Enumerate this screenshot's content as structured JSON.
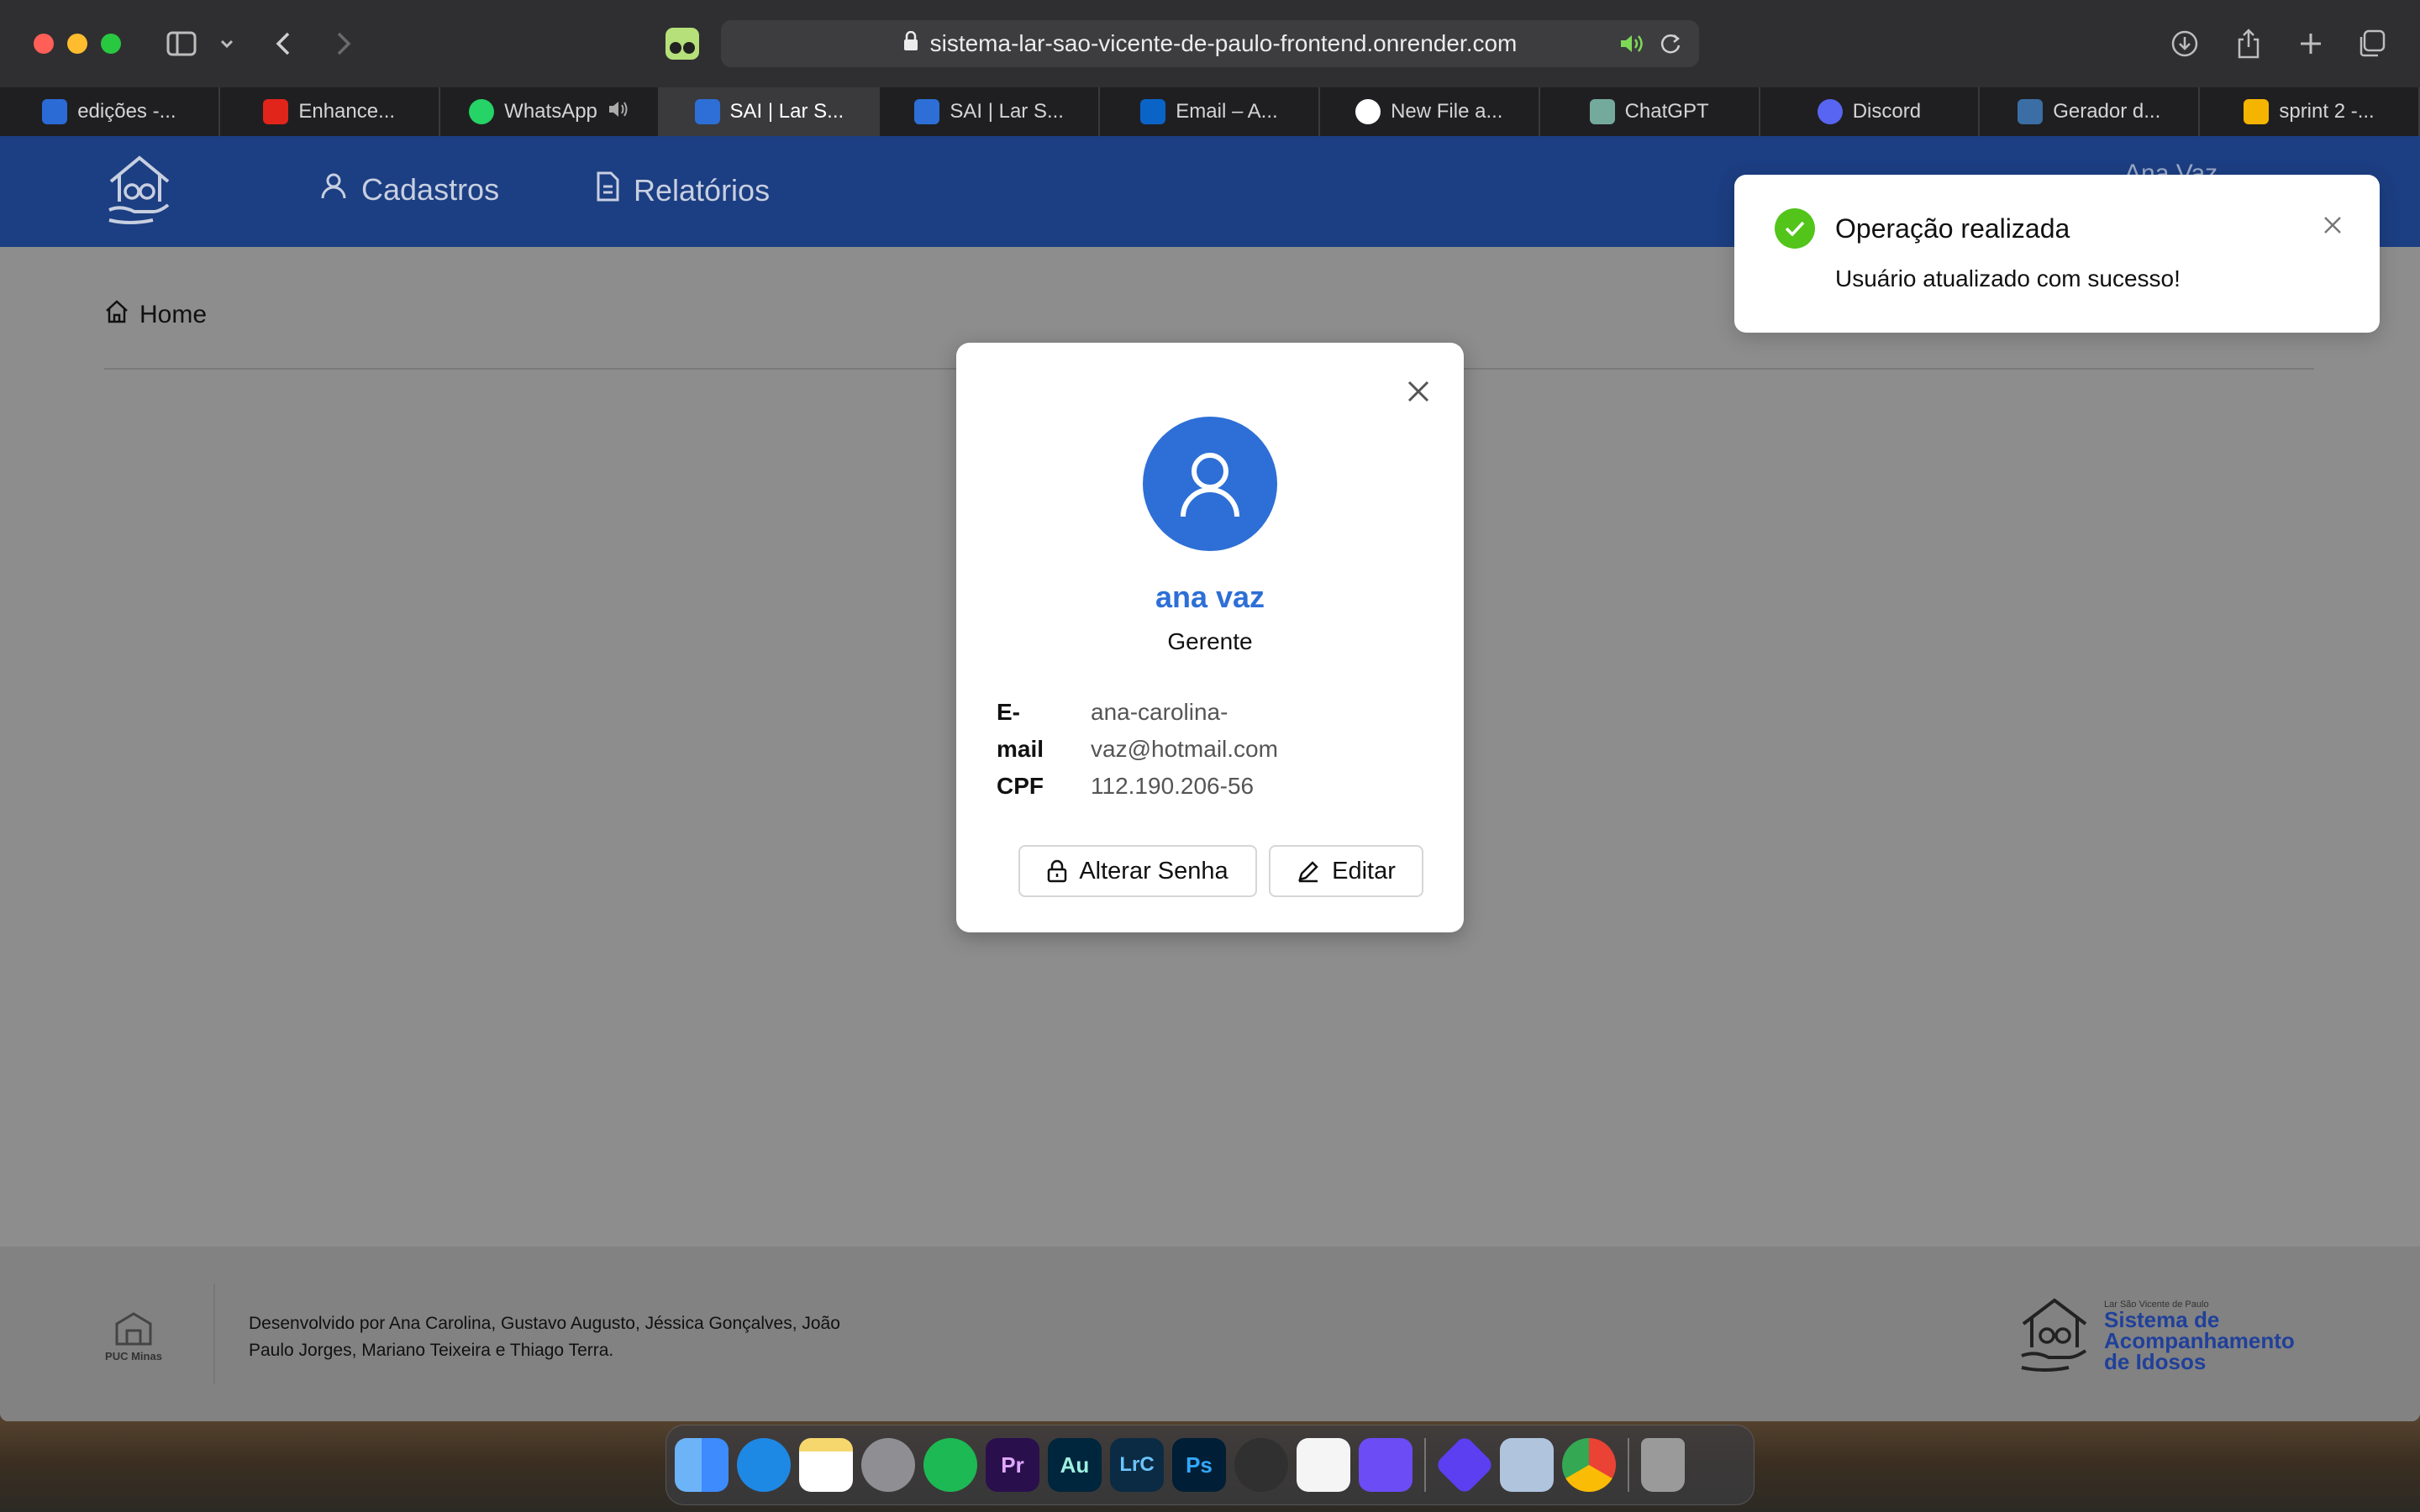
{
  "browser": {
    "url": "sistema-lar-sao-vicente-de-paulo-frontend.onrender.com",
    "tabs": [
      {
        "label": "edições -...",
        "favicon_color": "#2b6bd6"
      },
      {
        "label": "Enhance...",
        "favicon_color": "#e1251b"
      },
      {
        "label": "WhatsApp",
        "favicon_color": "#25d366"
      },
      {
        "label": "SAI | Lar S...",
        "favicon_color": "#2d6fd6",
        "active": true
      },
      {
        "label": "SAI | Lar S...",
        "favicon_color": "#2d6fd6"
      },
      {
        "label": "Email – A...",
        "favicon_color": "#0a64c8"
      },
      {
        "label": "New File a...",
        "favicon_color": "#ffffff"
      },
      {
        "label": "ChatGPT",
        "favicon_color": "#74aa9c"
      },
      {
        "label": "Discord",
        "favicon_color": "#5865f2"
      },
      {
        "label": "Gerador d...",
        "favicon_color": "#3a6ea5"
      },
      {
        "label": "sprint 2 -...",
        "favicon_color": "#f4b400"
      }
    ]
  },
  "header": {
    "nav_cadastros": "Cadastros",
    "nav_relatorios": "Relatórios",
    "user_name": "Ana Vaz",
    "bg_color": "#1c3e82"
  },
  "breadcrumb": {
    "home": "Home"
  },
  "modal": {
    "name": "ana vaz",
    "role": "Gerente",
    "email_label_1": "E-",
    "email_label_2": "mail",
    "email_value_1": "ana-carolina-",
    "email_value_2": "vaz@hotmail.com",
    "cpf_label": "CPF",
    "cpf_value": "112.190.206-56",
    "btn_change_password": "Alterar Senha",
    "btn_edit": "Editar",
    "accent_color": "#2d6fd6"
  },
  "toast": {
    "title": "Operação realizada",
    "message": "Usuário atualizado com sucesso!",
    "success_color": "#52c41a"
  },
  "footer": {
    "credits_line_1": "Desenvolvido por Ana Carolina, Gustavo Augusto, Jéssica Gonçalves, João",
    "credits_line_2": "Paulo Jorges, Mariano Teixeira e Thiago Terra.",
    "puc_logo_text": "PUC Minas",
    "brand_small": "Lar São Vicente de Paulo",
    "brand_line_1": "Sistema de",
    "brand_line_2": "Acompanhamento",
    "brand_line_3": "de Idosos"
  },
  "dock": {
    "apps": [
      {
        "name": "finder",
        "label": "",
        "color": "#3d8bfd"
      },
      {
        "name": "safari",
        "label": "",
        "color": "#1e88e5"
      },
      {
        "name": "notes",
        "label": "",
        "color": "#f5d76e"
      },
      {
        "name": "system-settings",
        "label": "",
        "color": "#8e8e93"
      },
      {
        "name": "spotify",
        "label": "",
        "color": "#1db954"
      },
      {
        "name": "premiere",
        "label": "Pr",
        "color": "#2a0f4d"
      },
      {
        "name": "audition",
        "label": "Au",
        "color": "#00263d"
      },
      {
        "name": "lightroom-classic",
        "label": "LrC",
        "color": "#0b2b44"
      },
      {
        "name": "photoshop",
        "label": "Ps",
        "color": "#001e36"
      },
      {
        "name": "davinci",
        "label": "",
        "color": "#303030"
      },
      {
        "name": "google-drive",
        "label": "",
        "color": "#f5f5f5"
      },
      {
        "name": "instruments",
        "label": "",
        "color": "#6c4cf5"
      },
      {
        "name": "infuse",
        "label": "",
        "color": "#5b3ff0"
      },
      {
        "name": "preview",
        "label": "",
        "color": "#b0c4de"
      },
      {
        "name": "chrome",
        "label": "",
        "color": "#4285f4"
      },
      {
        "name": "trash",
        "label": "",
        "color": "#9a9a9a"
      }
    ]
  }
}
